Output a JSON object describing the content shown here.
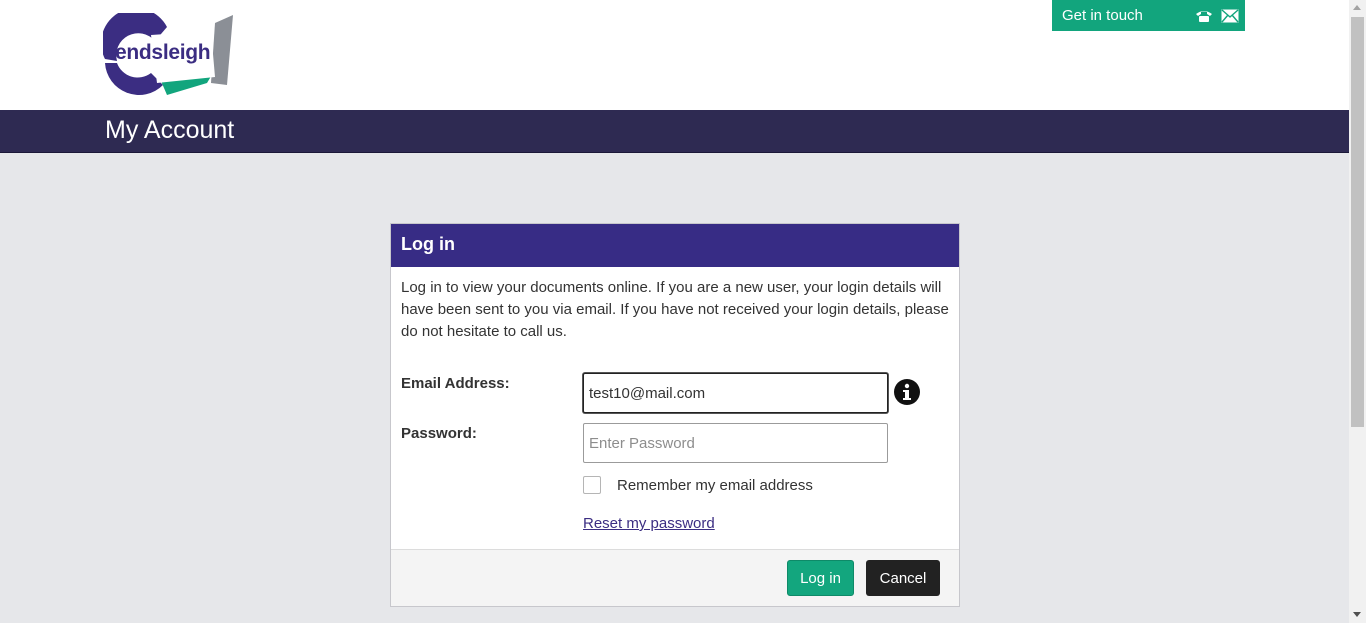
{
  "brand": {
    "logo_text": "endsleigh"
  },
  "contact": {
    "label": "Get in touch",
    "icons": [
      "phone-icon",
      "mail-icon"
    ],
    "color": "#12a57d"
  },
  "page": {
    "title": "My Account",
    "titlebar_color": "#2e2a52"
  },
  "login": {
    "heading": "Log in",
    "heading_color": "#372c85",
    "intro": "Log in to view your documents online. If you are a new user, your login details will have been sent to you via email. If you have not received your login details, please do not hesitate to call us.",
    "email_label": "Email Address:",
    "email_value": "test10@mail.com",
    "password_label": "Password:",
    "password_placeholder": "Enter Password",
    "remember_label": "Remember my email address",
    "remember_checked": false,
    "reset_link": "Reset my password",
    "login_button": "Log in",
    "cancel_button": "Cancel"
  }
}
